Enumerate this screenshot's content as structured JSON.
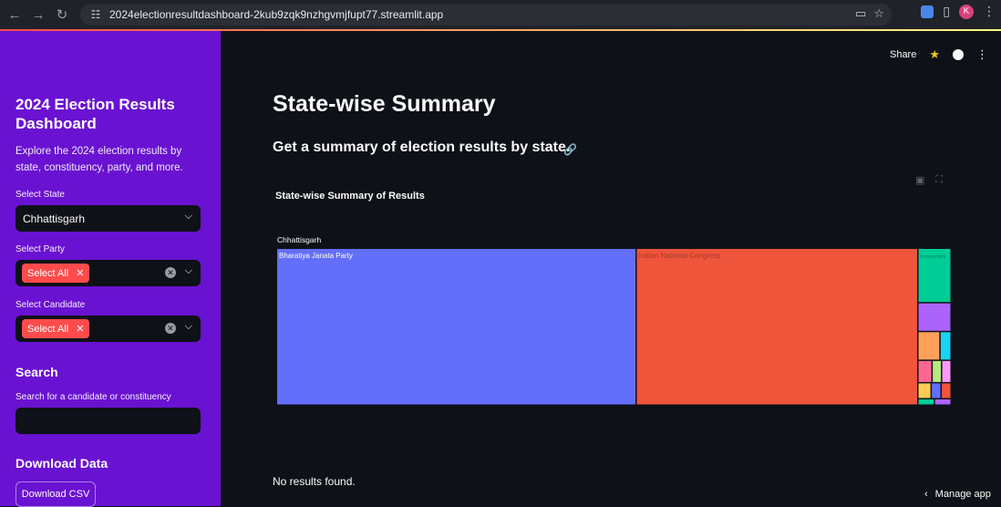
{
  "browser": {
    "url": "2024electionresultdashboard-2kub9zqk9nzhgvmjfupt77.streamlit.app",
    "profile_letter": "K",
    "icons": [
      "back-icon",
      "forward-icon",
      "reload-icon",
      "site-settings-icon",
      "cast-icon",
      "bookmark-star-icon",
      "extension-icon",
      "puzzle-icon",
      "profile-avatar",
      "menu-icon"
    ]
  },
  "sidebar": {
    "title": "2024 Election Results Dashboard",
    "description": "Explore the 2024 election results by state, constituency, party, and more.",
    "state_label": "Select State",
    "state_value": "Chhattisgarh",
    "party_label": "Select Party",
    "party_tag": "Select All",
    "candidate_label": "Select Candidate",
    "candidate_tag": "Select All",
    "search_heading": "Search",
    "search_label": "Search for a candidate or constituency",
    "search_value": "",
    "download_heading": "Download Data",
    "download_button": "Download CSV",
    "background_color": "#6a12d1"
  },
  "header": {
    "share": "Share"
  },
  "main": {
    "title": "State-wise Summary",
    "subtitle": "Get a summary of election results by state.",
    "chart_title": "State-wise Summary of Results",
    "no_results": "No results found.",
    "manage_app": "Manage app"
  },
  "chart_data": {
    "type": "treemap",
    "title": "State-wise Summary of Results",
    "root": "Chhattisgarh",
    "labels_visible": [
      "Bharatiya Janata Party",
      "Indian National Congress",
      "Independent"
    ],
    "items": [
      {
        "name": "Bharatiya Janata Party",
        "value": 53.0,
        "color": "#636efa"
      },
      {
        "name": "Indian National Congress",
        "value": 41.5,
        "color": "#ef553b"
      },
      {
        "name": "Independent",
        "value": 1.7,
        "color": "#00cc96"
      },
      {
        "name": "",
        "value": 0.9,
        "color": "#ab63fa"
      },
      {
        "name": "",
        "value": 0.6,
        "color": "#ffa15a"
      },
      {
        "name": "",
        "value": 0.3,
        "color": "#19d3f3"
      },
      {
        "name": "",
        "value": 0.3,
        "color": "#ff6692"
      },
      {
        "name": "",
        "value": 0.2,
        "color": "#b6e880"
      },
      {
        "name": "",
        "value": 0.2,
        "color": "#ff97ff"
      },
      {
        "name": "",
        "value": 0.2,
        "color": "#fecb52"
      },
      {
        "name": "",
        "value": 0.15,
        "color": "#636efa"
      },
      {
        "name": "",
        "value": 0.15,
        "color": "#ef553b"
      },
      {
        "name": "",
        "value": 0.1,
        "color": "#00cc96"
      },
      {
        "name": "",
        "value": 0.1,
        "color": "#ab63fa"
      }
    ]
  }
}
